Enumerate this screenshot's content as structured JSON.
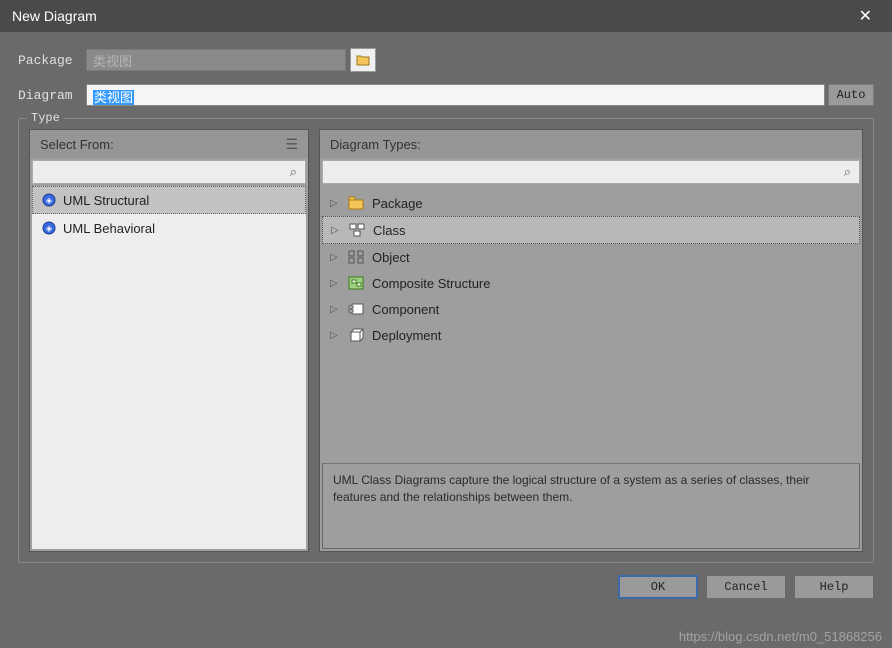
{
  "title": "New Diagram",
  "fields": {
    "package_label": "Package",
    "package_value": "类视图",
    "diagram_label": "Diagram",
    "diagram_value": "类视图",
    "auto_label": "Auto"
  },
  "type_group": {
    "legend": "Type",
    "select_from_header": "Select From:",
    "diagram_types_header": "Diagram Types:",
    "left_items": [
      {
        "label": "UML Structural",
        "selected": true
      },
      {
        "label": "UML Behavioral",
        "selected": false
      }
    ],
    "right_items": [
      {
        "label": "Package",
        "icon": "package",
        "selected": false
      },
      {
        "label": "Class",
        "icon": "class",
        "selected": true
      },
      {
        "label": "Object",
        "icon": "object",
        "selected": false
      },
      {
        "label": "Composite Structure",
        "icon": "composite",
        "selected": false
      },
      {
        "label": "Component",
        "icon": "component",
        "selected": false
      },
      {
        "label": "Deployment",
        "icon": "deployment",
        "selected": false
      }
    ],
    "description": "UML Class Diagrams capture the logical structure of a system as a series of classes, their features and the relationships between them."
  },
  "buttons": {
    "ok": "OK",
    "cancel": "Cancel",
    "help": "Help"
  },
  "watermark": "https://blog.csdn.net/m0_51868256"
}
